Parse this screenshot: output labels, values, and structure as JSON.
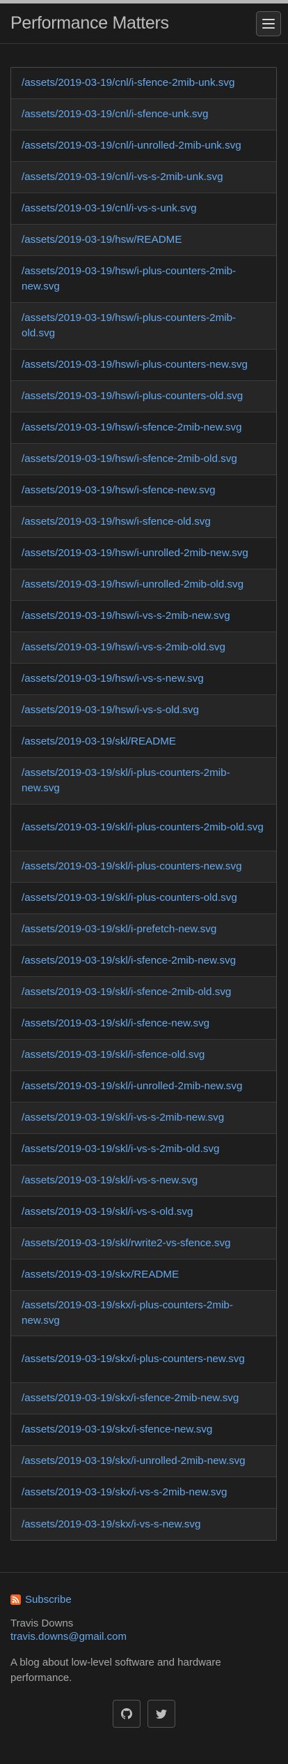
{
  "header": {
    "title": "Performance Matters"
  },
  "files": [
    "/assets/2019-03-19/cnl/i-sfence-2mib-unk.svg",
    "/assets/2019-03-19/cnl/i-sfence-unk.svg",
    "/assets/2019-03-19/cnl/i-unrolled-2mib-unk.svg",
    "/assets/2019-03-19/cnl/i-vs-s-2mib-unk.svg",
    "/assets/2019-03-19/cnl/i-vs-s-unk.svg",
    "/assets/2019-03-19/hsw/README",
    "/assets/2019-03-19/hsw/i-plus-counters-2mib-new.svg",
    "/assets/2019-03-19/hsw/i-plus-counters-2mib-old.svg",
    "/assets/2019-03-19/hsw/i-plus-counters-new.svg",
    "/assets/2019-03-19/hsw/i-plus-counters-old.svg",
    "/assets/2019-03-19/hsw/i-sfence-2mib-new.svg",
    "/assets/2019-03-19/hsw/i-sfence-2mib-old.svg",
    "/assets/2019-03-19/hsw/i-sfence-new.svg",
    "/assets/2019-03-19/hsw/i-sfence-old.svg",
    "/assets/2019-03-19/hsw/i-unrolled-2mib-new.svg",
    "/assets/2019-03-19/hsw/i-unrolled-2mib-old.svg",
    "/assets/2019-03-19/hsw/i-vs-s-2mib-new.svg",
    "/assets/2019-03-19/hsw/i-vs-s-2mib-old.svg",
    "/assets/2019-03-19/hsw/i-vs-s-new.svg",
    "/assets/2019-03-19/hsw/i-vs-s-old.svg",
    "/assets/2019-03-19/skl/README",
    "/assets/2019-03-19/skl/i-plus-counters-2mib-new.svg",
    "/assets/2019-03-19/skl/i-plus-counters-2mib-old.svg",
    "/assets/2019-03-19/skl/i-plus-counters-new.svg",
    "/assets/2019-03-19/skl/i-plus-counters-old.svg",
    "/assets/2019-03-19/skl/i-prefetch-new.svg",
    "/assets/2019-03-19/skl/i-sfence-2mib-new.svg",
    "/assets/2019-03-19/skl/i-sfence-2mib-old.svg",
    "/assets/2019-03-19/skl/i-sfence-new.svg",
    "/assets/2019-03-19/skl/i-sfence-old.svg",
    "/assets/2019-03-19/skl/i-unrolled-2mib-new.svg",
    "/assets/2019-03-19/skl/i-vs-s-2mib-new.svg",
    "/assets/2019-03-19/skl/i-vs-s-2mib-old.svg",
    "/assets/2019-03-19/skl/i-vs-s-new.svg",
    "/assets/2019-03-19/skl/i-vs-s-old.svg",
    "/assets/2019-03-19/skl/rwrite2-vs-sfence.svg",
    "/assets/2019-03-19/skx/README",
    "/assets/2019-03-19/skx/i-plus-counters-2mib-new.svg",
    "/assets/2019-03-19/skx/i-plus-counters-new.svg",
    "/assets/2019-03-19/skx/i-sfence-2mib-new.svg",
    "/assets/2019-03-19/skx/i-sfence-new.svg",
    "/assets/2019-03-19/skx/i-unrolled-2mib-new.svg",
    "/assets/2019-03-19/skx/i-vs-s-2mib-new.svg",
    "/assets/2019-03-19/skx/i-vs-s-new.svg"
  ],
  "footer": {
    "subscribe": "Subscribe",
    "author": "Travis Downs",
    "email": "travis.downs@gmail.com",
    "description": "A blog about low-level software and hardware performance.",
    "social_icons": [
      "github-icon",
      "twitter-icon"
    ]
  },
  "colors": {
    "link": "#66aaee",
    "background": "#1b1b1b",
    "rss": "#f26522"
  }
}
